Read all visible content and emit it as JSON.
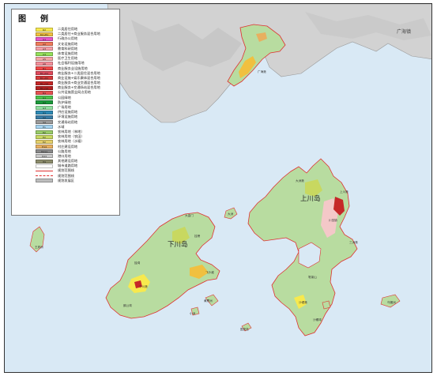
{
  "legend": {
    "title": "图例",
    "items": [
      {
        "code": "R2",
        "label": "二类居住用地",
        "color": "#f7e94e"
      },
      {
        "code": "R2+B1",
        "label": "二类居住+商业服务混合用地",
        "color": "#f0c040"
      },
      {
        "code": "A1",
        "label": "行政办公用地",
        "color": "#e455c8"
      },
      {
        "code": "A2",
        "label": "文化设施用地",
        "color": "#f07a5a"
      },
      {
        "code": "A3",
        "label": "教育科研用地",
        "color": "#f4a0a8"
      },
      {
        "code": "A4",
        "label": "体育设施用地",
        "color": "#94e05a"
      },
      {
        "code": "A5",
        "label": "医疗卫生用地",
        "color": "#f4a6a6"
      },
      {
        "code": "A6",
        "label": "社会福利设施用地",
        "color": "#f48f9a"
      },
      {
        "code": "B1",
        "label": "商业服务业设施用地",
        "color": "#f04848"
      },
      {
        "code": "B1+R2",
        "label": "商业服务+二类居住混合用地",
        "color": "#e0485a"
      },
      {
        "code": "B1+B3",
        "label": "商业设施+娱乐康体混合用地",
        "color": "#d63a3a"
      },
      {
        "code": "B1+S4",
        "label": "商业服务+商业交通混合用地",
        "color": "#c62828"
      },
      {
        "code": "B1+S4",
        "label": "商业服务+交通场站混合用地",
        "color": "#b32020"
      },
      {
        "code": "B4",
        "label": "公共设施营业网点用地",
        "color": "#e65050"
      },
      {
        "code": "G1",
        "label": "公园绿地",
        "color": "#4cc24c"
      },
      {
        "code": "G2",
        "label": "防护绿地",
        "color": "#1a9a3a"
      },
      {
        "code": "G3",
        "label": "广场用地",
        "color": "#90e0a0"
      },
      {
        "code": "U1",
        "label": "供应设施用地",
        "color": "#2d8ab5"
      },
      {
        "code": "U2",
        "label": "环境设施用地",
        "color": "#3a7ca5"
      },
      {
        "code": "S4",
        "label": "交通场站用地",
        "color": "#9a9a9a"
      },
      {
        "code": "E1",
        "label": "水域",
        "color": "#a6d4f0"
      },
      {
        "code": "E2",
        "label": "农林用地（林地）",
        "color": "#9acc6a"
      },
      {
        "code": "E2",
        "label": "农林用地（农田）",
        "color": "#c8d860"
      },
      {
        "code": "E2",
        "label": "农林用地（水塘）",
        "color": "#e4d06a"
      },
      {
        "code": "H14",
        "label": "村庄建设用地",
        "color": "#e8b060"
      },
      {
        "code": "H211",
        "label": "公路用地",
        "color": "#8a8a8a"
      },
      {
        "code": "H23",
        "label": "港口用地",
        "color": "#c8c8c8"
      },
      {
        "code": "H9",
        "label": "其他建设用地",
        "color": "#8c8c6c"
      },
      {
        "code": "",
        "label": "城市道路用地",
        "color": "#ffffff",
        "style": "box"
      },
      {
        "code": "",
        "label": "规划范围线",
        "color": "#e03030",
        "style": "line"
      },
      {
        "code": "",
        "label": "规划范围线",
        "color": "#e03030",
        "style": "dash"
      },
      {
        "code": "",
        "label": "规划发展区",
        "color": "#bdbdbd"
      }
    ]
  },
  "map": {
    "xiachuan_label": "下川岛",
    "shangchuan_label": "上川岛",
    "haiyan_label": "广海镇",
    "small_labels": [
      "大洲港",
      "上川港",
      "川岛镇",
      "三洲港",
      "沙堤港",
      "王府洲",
      "下川港",
      "独湾",
      "挂榜",
      "乌猪洲",
      "广海港",
      "大洲",
      "黄麖洲",
      "围夹岛",
      "大金门",
      "飞沙滩",
      "鹅公湾",
      "小洲",
      "笔架山",
      "沙螺湾"
    ],
    "colors": {
      "sea": "#d9e9f5",
      "forest": "#b8dca0",
      "mainland": "#d5d5d5",
      "boundary": "#e03030"
    }
  }
}
